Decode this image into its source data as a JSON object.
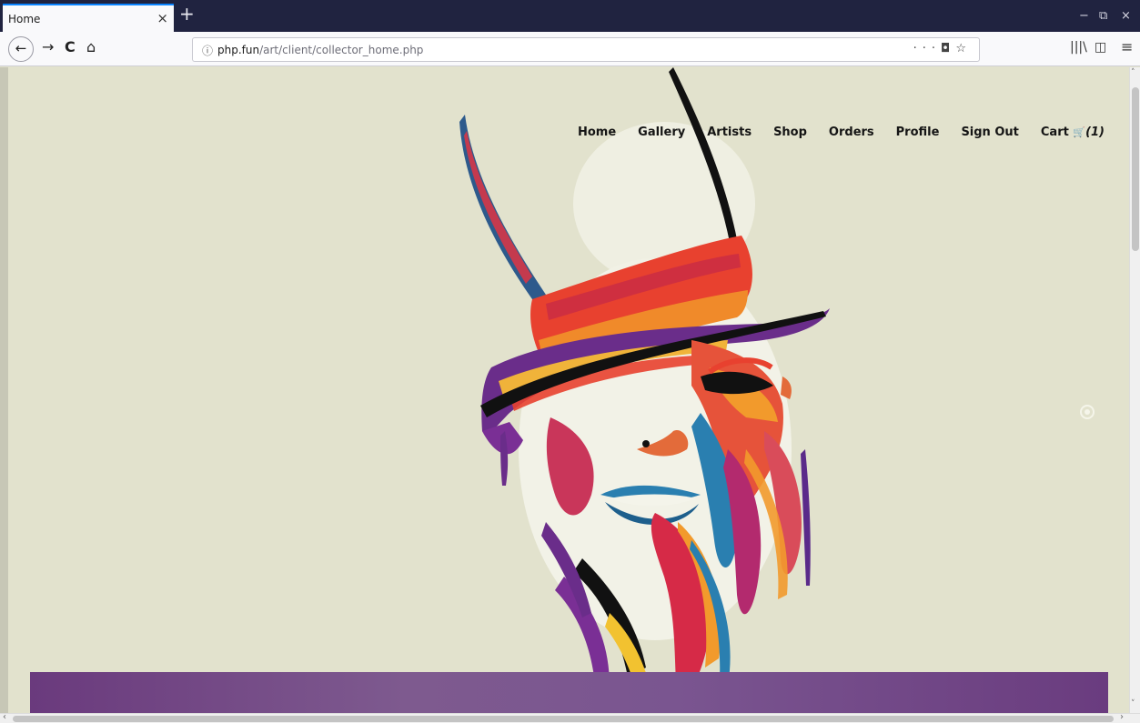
{
  "browser": {
    "tab_title": "Home",
    "tab_close": "×",
    "new_tab": "+",
    "window_minimize": "−",
    "window_restore": "⧉",
    "window_close": "×",
    "back": "←",
    "forward": "→",
    "reload": "C",
    "home": "⌂",
    "url_info": "ⓘ",
    "url_host": "php.fun",
    "url_path": "/art/client/collector_home.php",
    "page_actions": "···",
    "pocket": "◘",
    "bookmark": "☆",
    "library": "|||\\",
    "sidebar": "◫",
    "menu": "≡"
  },
  "site": {
    "nav": {
      "home": "Home",
      "gallery": "Gallery",
      "artists": "Artists",
      "shop": "Shop",
      "orders": "Orders",
      "profile": "Profile",
      "sign_out": "Sign Out",
      "cart_label": "Cart",
      "cart_icon": "🛒",
      "cart_count": "(1)"
    }
  },
  "scroll": {
    "up": "˄",
    "down": "˅",
    "left": "‹",
    "right": "›"
  },
  "colors": {
    "page_bg": "#e2e2cd",
    "band": "#7a5590",
    "tab_accent": "#0a84ff"
  }
}
